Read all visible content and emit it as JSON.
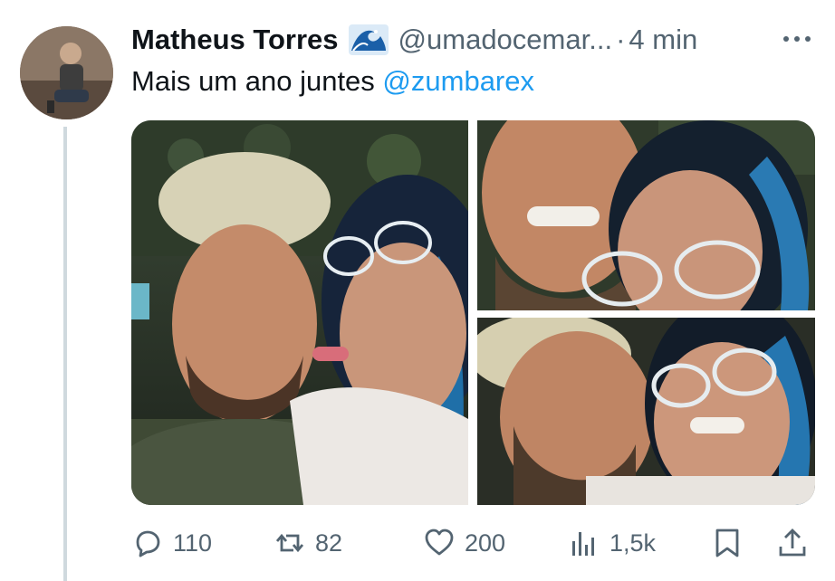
{
  "tweet": {
    "author_name": "Matheus Torres",
    "author_emoji": "🌊",
    "handle": "@umadocemar...",
    "dot": "·",
    "time": "4 min",
    "text_before": "Mais um ano juntes ",
    "mention": "@zumbarex",
    "mention_color": "#1d9bf0"
  },
  "media": {
    "images": [
      {
        "name": "selfie-kiss"
      },
      {
        "name": "selfie-smiling"
      },
      {
        "name": "selfie-cheek"
      }
    ]
  },
  "actions": {
    "reply": {
      "icon": "reply-icon",
      "count": "110"
    },
    "repost": {
      "icon": "repost-icon",
      "count": "82"
    },
    "like": {
      "icon": "heart-icon",
      "count": "200"
    },
    "views": {
      "icon": "views-icon",
      "count": "1,5k"
    },
    "bookmark": {
      "icon": "bookmark-icon"
    },
    "share": {
      "icon": "share-icon"
    }
  }
}
